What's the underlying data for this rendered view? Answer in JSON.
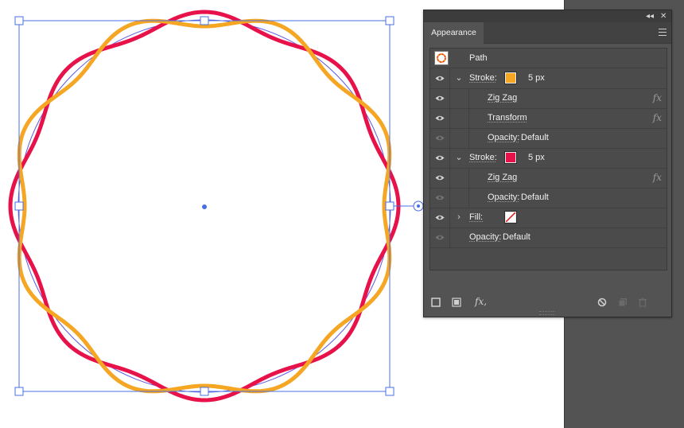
{
  "window": {
    "collapse_glyph": "◂◂",
    "close_glyph": "✕"
  },
  "panel": {
    "tab_label": "Appearance",
    "header_label": "Path",
    "rows": [
      {
        "label": "Stroke:",
        "value": "5 px"
      },
      {
        "label": "Zig Zag",
        "fx": "fx"
      },
      {
        "label": "Transform",
        "fx": "fx"
      },
      {
        "label": "Opacity:",
        "value": "Default"
      },
      {
        "label": "Stroke:",
        "value": "5 px"
      },
      {
        "label": "Zig Zag",
        "fx": "fx"
      },
      {
        "label": "Opacity:",
        "value": "Default"
      },
      {
        "label": "Fill:"
      },
      {
        "label": "Opacity:",
        "value": "Default"
      }
    ],
    "chevrons": {
      "expanded": "⌄",
      "collapsed": "›"
    },
    "bottom_fx": "fx,"
  },
  "colors": {
    "stroke_1": "#F5A623",
    "stroke_2": "#E8124A",
    "selection": "#4A6FE3",
    "panel_bg": "#535353"
  },
  "icons": [
    "eye-icon",
    "menu-icon",
    "fx-icon",
    "new-stroke-icon",
    "new-fill-icon",
    "clear-appearance-icon",
    "duplicate-item-icon",
    "delete-item-icon"
  ]
}
